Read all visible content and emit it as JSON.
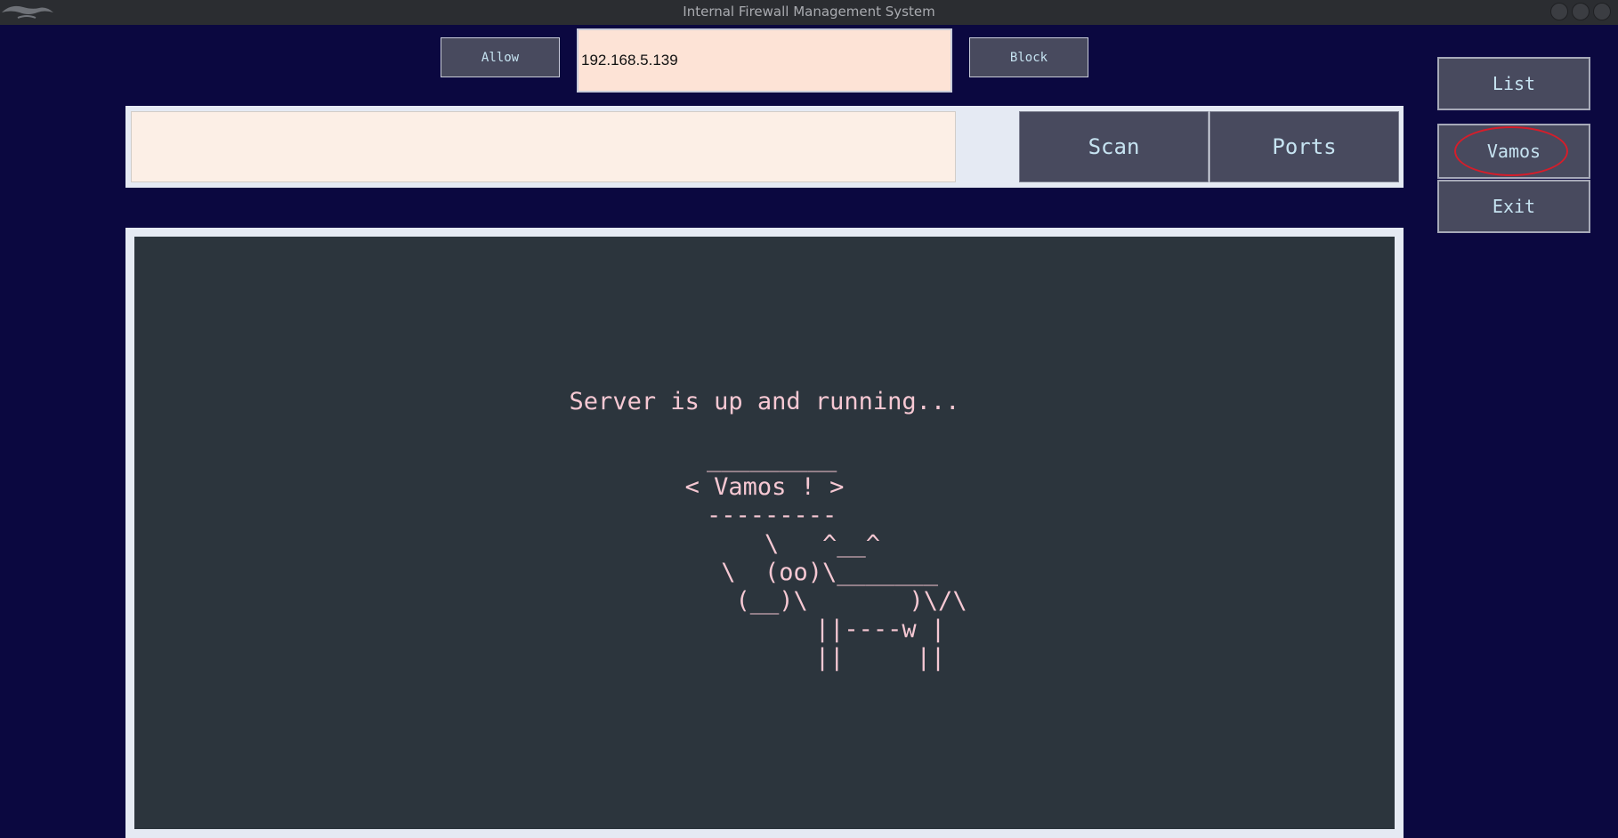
{
  "window": {
    "title": "Internal Firewall Management System"
  },
  "toolbar": {
    "allow_label": "Allow",
    "block_label": "Block",
    "ip_value": "192.168.5.139"
  },
  "command": {
    "value": "",
    "scan_label": "Scan",
    "ports_label": "Ports"
  },
  "sidebar": {
    "list_label": "List",
    "vamos_label": "Vamos",
    "exit_label": "Exit"
  },
  "console": {
    "output": "Server is up and running...\n\n _________\n< Vamos ! >\n ---------\n        \\   ^__^\n         \\  (oo)\\_______\n            (__)\\       )\\/\\\n                ||----w |\n                ||     ||"
  },
  "colors": {
    "background": "#0b0840",
    "button": "#484a5e",
    "button_text": "#c6e3f1",
    "console_bg": "#2c353d",
    "console_text": "#f6c8d3",
    "highlight": "#d61d2a"
  }
}
